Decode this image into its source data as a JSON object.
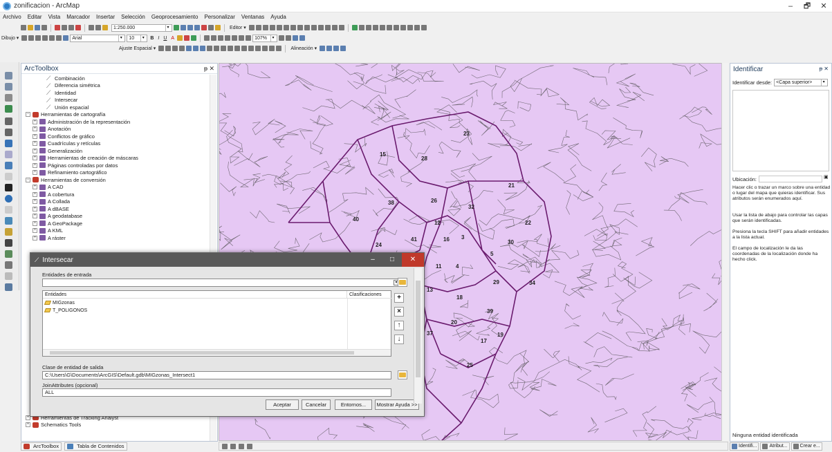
{
  "window": {
    "title": "zonificacion - ArcMap",
    "controls": [
      "–",
      "🗗",
      "✕"
    ]
  },
  "menu": [
    "Archivo",
    "Editar",
    "Vista",
    "Marcador",
    "Insertar",
    "Selección",
    "Geoprocesamiento",
    "Personalizar",
    "Ventanas",
    "Ayuda"
  ],
  "toolbar": {
    "scale": "1:250.000",
    "editor_label": "Editor ▾",
    "draw_label": "Dibujo ▾",
    "font_name": "Arial",
    "font_size": "10",
    "zoom_pct": "107%",
    "snap_label": "Ajuste Espacial ▾",
    "align_label": "Alineación ▾"
  },
  "toolbox": {
    "title": "ArcToolbox",
    "pin": "ᵽ ✕",
    "rows": [
      {
        "indent": 3,
        "kind": "tool",
        "label": "Combinación"
      },
      {
        "indent": 3,
        "kind": "tool",
        "label": "Diferencia simétrica"
      },
      {
        "indent": 3,
        "kind": "tool",
        "label": "Identidad"
      },
      {
        "indent": 3,
        "kind": "tool",
        "label": "Intersecar"
      },
      {
        "indent": 3,
        "kind": "tool",
        "label": "Unión espacial"
      },
      {
        "indent": 0,
        "kind": "box",
        "pm": "−",
        "label": "Herramientas de cartografía"
      },
      {
        "indent": 1,
        "kind": "set",
        "pm": "+",
        "label": "Administración de la representación"
      },
      {
        "indent": 1,
        "kind": "set",
        "pm": "+",
        "label": "Anotación"
      },
      {
        "indent": 1,
        "kind": "set",
        "pm": "+",
        "label": "Conflictos de gráfico"
      },
      {
        "indent": 1,
        "kind": "set",
        "pm": "+",
        "label": "Cuadrículas y retículas"
      },
      {
        "indent": 1,
        "kind": "set",
        "pm": "+",
        "label": "Generalización"
      },
      {
        "indent": 1,
        "kind": "set",
        "pm": "+",
        "label": "Herramientas de creación de máscaras"
      },
      {
        "indent": 1,
        "kind": "set",
        "pm": "+",
        "label": "Páginas controladas por datos"
      },
      {
        "indent": 1,
        "kind": "set",
        "pm": "+",
        "label": "Refinamiento cartográfico"
      },
      {
        "indent": 0,
        "kind": "box",
        "pm": "−",
        "label": "Herramientas de conversión"
      },
      {
        "indent": 1,
        "kind": "set",
        "pm": "+",
        "label": "A CAD"
      },
      {
        "indent": 1,
        "kind": "set",
        "pm": "+",
        "label": "A cobertura"
      },
      {
        "indent": 1,
        "kind": "set",
        "pm": "+",
        "label": "A Collada"
      },
      {
        "indent": 1,
        "kind": "set",
        "pm": "+",
        "label": "A dBASE"
      },
      {
        "indent": 1,
        "kind": "set",
        "pm": "+",
        "label": "A geodatabase"
      },
      {
        "indent": 1,
        "kind": "set",
        "pm": "+",
        "label": "A GeoPackage"
      },
      {
        "indent": 1,
        "kind": "set",
        "pm": "+",
        "label": "A KML"
      },
      {
        "indent": 1,
        "kind": "set",
        "pm": "+",
        "label": "A ráster"
      }
    ],
    "bottom_rows": [
      {
        "label": "Herramientas de Tracking Analyst"
      },
      {
        "label": "Schematics Tools"
      }
    ],
    "tabs": [
      "ArcToolbox",
      "Tabla de Contenidos"
    ]
  },
  "map": {
    "fill": "#e6c8f4",
    "zones": [
      {
        "id": "15"
      },
      {
        "id": "28"
      },
      {
        "id": "23"
      },
      {
        "id": "21"
      },
      {
        "id": "38"
      },
      {
        "id": "26"
      },
      {
        "id": "32"
      },
      {
        "id": "40"
      },
      {
        "id": "12"
      },
      {
        "id": "22"
      },
      {
        "id": "41"
      },
      {
        "id": "16"
      },
      {
        "id": "24"
      },
      {
        "id": "3"
      },
      {
        "id": "5"
      },
      {
        "id": "30"
      },
      {
        "id": "11"
      },
      {
        "id": "4"
      },
      {
        "id": "29"
      },
      {
        "id": "34"
      },
      {
        "id": "13"
      },
      {
        "id": "18"
      },
      {
        "id": "39"
      },
      {
        "id": "20"
      },
      {
        "id": "37"
      },
      {
        "id": "19"
      },
      {
        "id": "25"
      },
      {
        "id": "17"
      }
    ]
  },
  "identify": {
    "title": "Identificar",
    "pin": "ᵽ ✕",
    "from_label": "Identificar desde:",
    "from_value": "<Capa superior>",
    "location_label": "Ubicación:",
    "help_1": "Hacer clic o trazar un marco sobre una entidad o lugar del mapa que quieras identificar. Sus atributos serán enumerados aquí.",
    "help_2": "Usar la lista de abajo para controlar las capas que serán identificadas.",
    "help_3": "Presiona la tecla SHIFT para añadir entidades a la lista actual.",
    "help_4": "El campo de localización le da las coordenadas de la localización donde ha hecho click.",
    "status": "Ninguna entidad identificada",
    "tabs": [
      "Identifi...",
      "Atribut...",
      "Crear e..."
    ]
  },
  "dialog": {
    "title": "Intersecar",
    "input_label": "Entidades de entrada",
    "col_entities": "Entidades",
    "col_ranks": "Clasificaciones",
    "entities": [
      "MIGzonas",
      "T_POLIGONOS"
    ],
    "output_label": "Clase de entidad de salida",
    "output_value": "C:\\Users\\G\\Documents\\ArcGIS\\Default.gdb\\MIGzonas_Intersect1",
    "join_label": "JoinAttributes (opcional)",
    "join_value": "ALL",
    "buttons": {
      "ok": "Aceptar",
      "cancel": "Cancelar",
      "env": "Entornos...",
      "help": "Mostrar Ayuda >>"
    },
    "controls": [
      "–",
      "□",
      "✕"
    ]
  }
}
